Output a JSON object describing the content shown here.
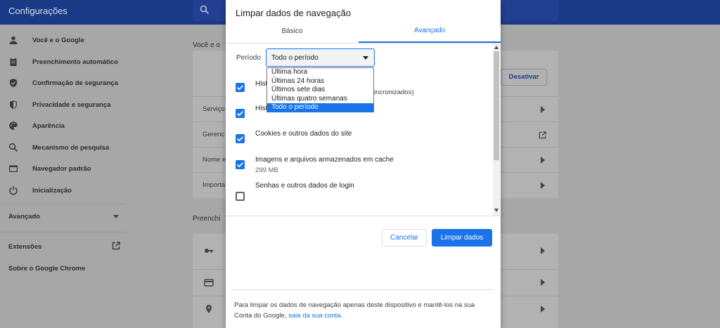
{
  "app": {
    "title": "Configurações"
  },
  "sidebar": {
    "items": [
      {
        "label": "Você e o Google",
        "icon": "person-icon"
      },
      {
        "label": "Preenchimento automático",
        "icon": "clipboard-icon"
      },
      {
        "label": "Confirmação de segurança",
        "icon": "shield-check-icon"
      },
      {
        "label": "Privacidade e segurança",
        "icon": "shield-icon"
      },
      {
        "label": "Aparência",
        "icon": "palette-icon"
      },
      {
        "label": "Mecanismo de pesquisa",
        "icon": "search-icon"
      },
      {
        "label": "Navegador padrão",
        "icon": "browser-icon"
      },
      {
        "label": "Inicialização",
        "icon": "power-icon"
      }
    ],
    "advanced_label": "Avançado",
    "extensions_label": "Extensões",
    "about_label": "Sobre o Google Chrome"
  },
  "background": {
    "section1_title": "Você e o",
    "section2_title": "Preenchi",
    "deactivate_label": "Desativar",
    "rows": [
      "Serviço",
      "Gerenc",
      "Nome e",
      "Importa"
    ]
  },
  "dialog": {
    "title": "Limpar dados de navegação",
    "tabs": {
      "basic": "Básico",
      "advanced": "Avançado"
    },
    "period_label": "Período",
    "period_value": "Todo o período",
    "period_options": [
      "Última hora",
      "Últimas 24 horas",
      "Últimos sete dias",
      "Últimas quatro semanas",
      "Todo o período"
    ],
    "options": [
      {
        "title": "Hist",
        "sub": "",
        "checked": true
      },
      {
        "title": "Hist",
        "sub": "",
        "checked": true,
        "tail": "incronizados)"
      },
      {
        "title": "Cookies e outros dados do site",
        "sub": "",
        "checked": true
      },
      {
        "title": "Imagens e arquivos armazenados em cache",
        "sub": "299 MB",
        "checked": true
      },
      {
        "title": "Senhas e outros dados de login",
        "sub": "",
        "checked": false
      }
    ],
    "cancel_label": "Cancelar",
    "clear_label": "Limpar dados",
    "footer_text": "Para limpar os dados de navegação apenas deste dispositivo e mantê-los na sua Conta do Google,",
    "footer_link": "saia da sua conta",
    "footer_end": "."
  },
  "colors": {
    "accent": "#1a73e8",
    "topbar": "#1a3a85"
  }
}
